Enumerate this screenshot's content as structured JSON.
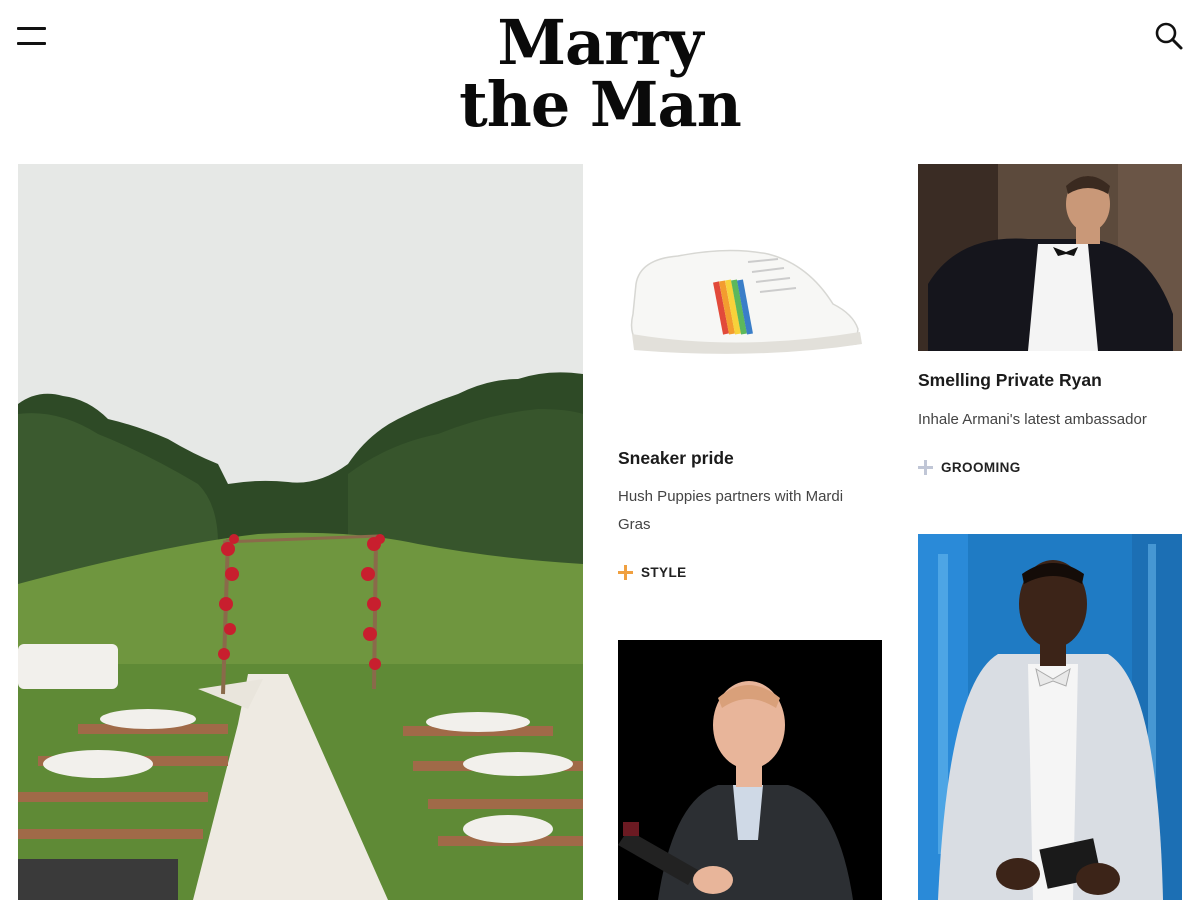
{
  "header": {
    "logo_line1": "Marry",
    "logo_line2": "the Man",
    "menu_icon": "hamburger-menu-icon",
    "search_icon": "search-icon"
  },
  "hero": {
    "image": "outdoor-wedding-ceremony-photo"
  },
  "articles": [
    {
      "title": "Sneaker pride",
      "subtitle": "Hush Puppies partners with Mardi Gras",
      "tag": "STYLE",
      "tag_color": "#f0a040",
      "image": "rainbow-sneaker-photo"
    },
    {
      "title": "Smelling Private Ryan",
      "subtitle": "Inhale Armani's latest ambassador",
      "tag": "GROOMING",
      "tag_color": "#c0c6d6",
      "image": "man-in-tuxedo-photo"
    },
    {
      "title": "",
      "subtitle": "",
      "tag": "",
      "image": "man-holding-wine-bottle-photo"
    },
    {
      "title": "",
      "subtitle": "",
      "tag": "",
      "image": "man-in-silver-jacket-photo"
    }
  ]
}
